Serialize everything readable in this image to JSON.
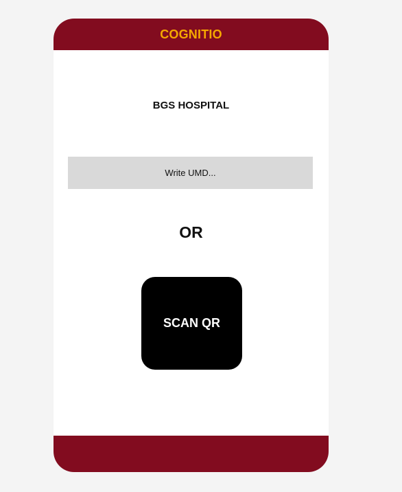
{
  "header": {
    "title": "COGNITIO"
  },
  "hospital": {
    "name": "BGS HOSPITAL"
  },
  "umd_input": {
    "value": "",
    "placeholder": "Write UMD..."
  },
  "divider": {
    "label": "OR"
  },
  "scan_button": {
    "label": "SCAN QR"
  },
  "colors": {
    "brand": "#820c1f",
    "title_accent": "#f5a800",
    "input_bg": "#d9d9d9",
    "button_bg": "#000000",
    "page_bg": "#f4f4f4"
  }
}
